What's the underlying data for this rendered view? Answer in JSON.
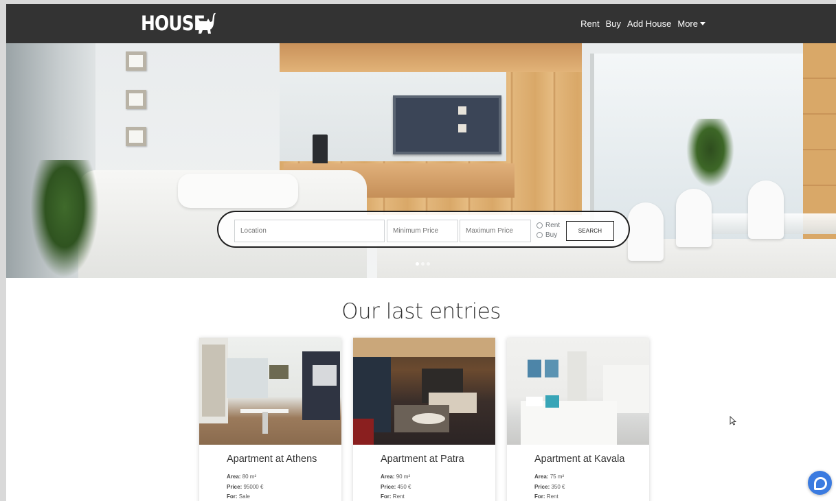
{
  "navbar": {
    "brand": "HOUSE",
    "links": {
      "rent": "Rent",
      "buy": "Buy",
      "add_house": "Add House",
      "more": "More"
    },
    "background": "#333333"
  },
  "hero": {
    "prev_arrow": "‹",
    "carousel_slide_count": 3,
    "carousel_active_index": 0
  },
  "search": {
    "location_placeholder": "Location",
    "min_price_placeholder": "Minimum Price",
    "max_price_placeholder": "Maximum Price",
    "radio_rent": "Rent",
    "radio_buy": "Buy",
    "button": "SEARCH"
  },
  "entries": {
    "title": "Our last entries",
    "cards": [
      {
        "title": "Apartment at Athens",
        "area_label": "Area:",
        "area": "80 m²",
        "price_label": "Price:",
        "price": "95000 €",
        "for_label": "For:",
        "for": "Sale"
      },
      {
        "title": "Apartment at Patra",
        "area_label": "Area:",
        "area": "90 m²",
        "price_label": "Price:",
        "price": "450 €",
        "for_label": "For:",
        "for": "Rent"
      },
      {
        "title": "Apartment at Kavala",
        "area_label": "Area:",
        "area": "75 m²",
        "price_label": "Price:",
        "price": "350 €",
        "for_label": "For:",
        "for": "Rent"
      }
    ]
  },
  "chat": {
    "icon": "chat-bubble-icon",
    "color": "#3b7be0"
  }
}
